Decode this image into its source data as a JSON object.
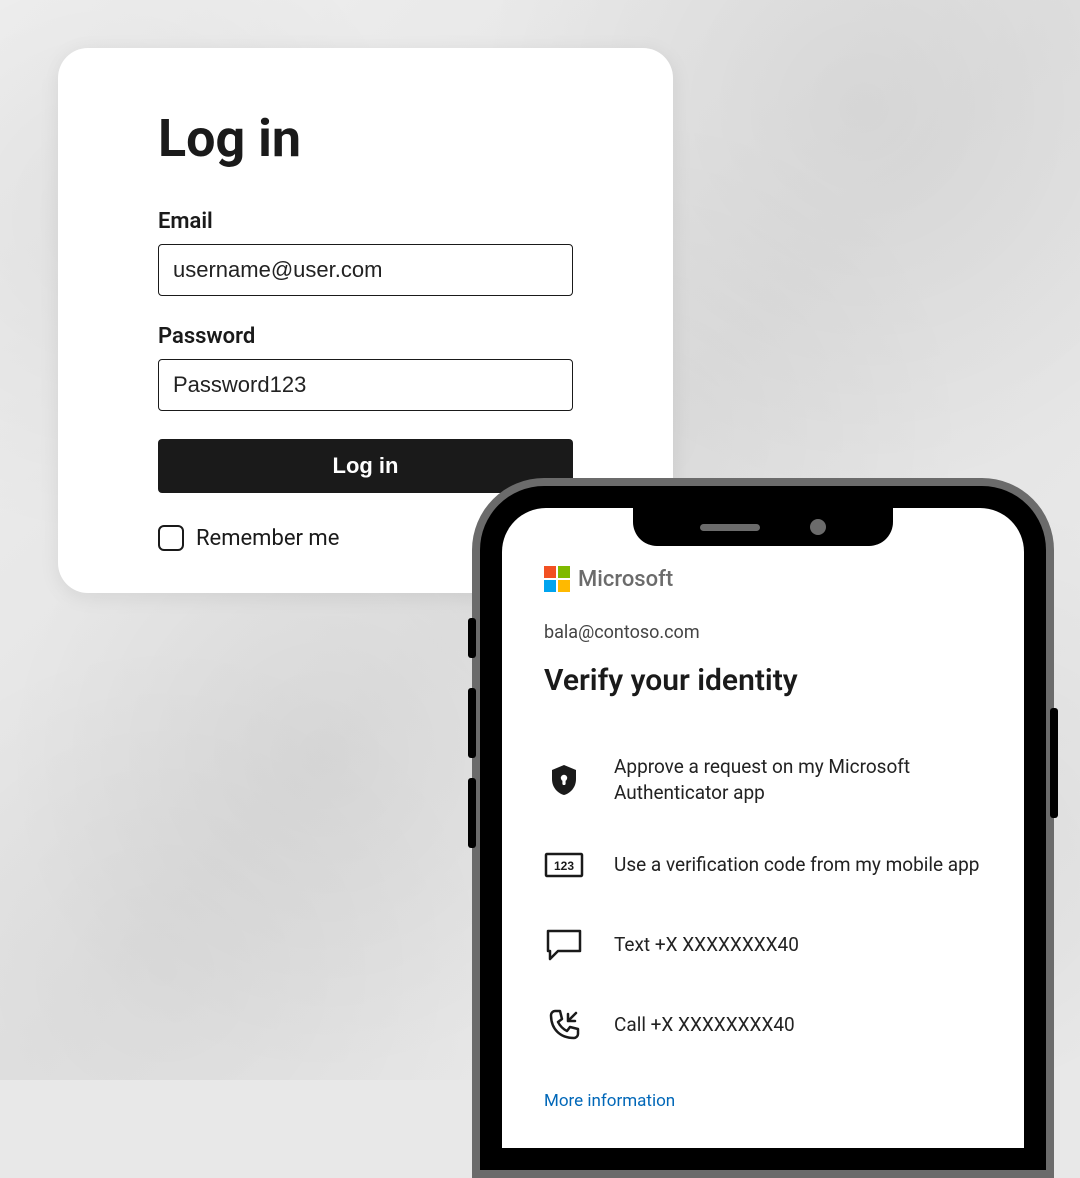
{
  "login": {
    "title": "Log in",
    "email_label": "Email",
    "email_value": "username@user.com",
    "password_label": "Password",
    "password_value": "Password123",
    "submit_label": "Log in",
    "remember_label": "Remember me"
  },
  "mfa": {
    "brand": "Microsoft",
    "account": "bala@contoso.com",
    "title": "Verify your identity",
    "options": [
      {
        "icon": "lock-shield-icon",
        "text": "Approve a request on my Microsoft Authenticator app"
      },
      {
        "icon": "code-123-icon",
        "text": "Use a verification code from my mobile app"
      },
      {
        "icon": "sms-icon",
        "text": "Text +X XXXXXXXX40"
      },
      {
        "icon": "phone-call-icon",
        "text": "Call +X XXXXXXXX40"
      }
    ],
    "more_link": "More information"
  }
}
